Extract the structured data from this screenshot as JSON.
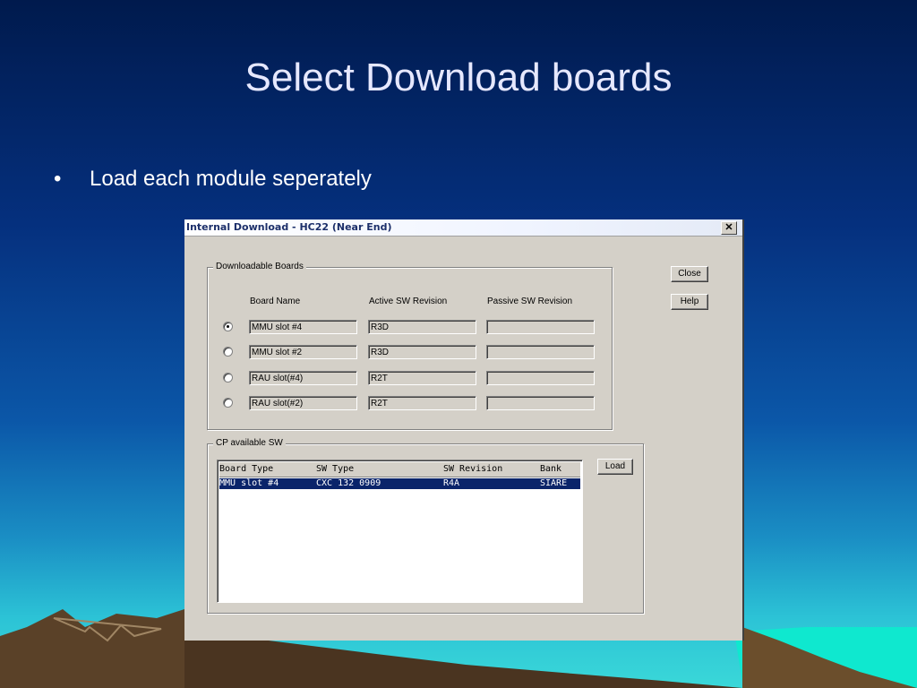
{
  "slide": {
    "title": "Select Download boards",
    "bullet_marker": "•",
    "bullet": "Load each module seperately"
  },
  "dialog": {
    "title": "Internal Download  -  HC22  (Near End)",
    "close_glyph": "✕",
    "downloadable_group_label": "Downloadable Boards",
    "columns": {
      "board_name": "Board Name",
      "active_sw": "Active SW Revision",
      "passive_sw": "Passive SW Revision"
    },
    "boards": [
      {
        "name": "MMU slot #4",
        "active": "R3D",
        "passive": "",
        "selected": true
      },
      {
        "name": "MMU slot #2",
        "active": "R3D",
        "passive": "",
        "selected": false
      },
      {
        "name": "RAU slot(#4)",
        "active": "R2T",
        "passive": "",
        "selected": false
      },
      {
        "name": "RAU slot(#2)",
        "active": "R2T",
        "passive": "",
        "selected": false
      }
    ],
    "buttons": {
      "close": "Close",
      "help": "Help",
      "load": "Load"
    },
    "cp_group_label": "CP available SW",
    "sw_list": {
      "headers": {
        "board_type": "Board Type",
        "sw_type": "SW Type",
        "sw_revision": "SW Revision",
        "bank": "Bank"
      },
      "rows": [
        {
          "board_type": "MMU slot #4",
          "sw_type": "CXC 132 0909",
          "sw_revision": "R4A",
          "bank": "SIARE"
        }
      ]
    }
  }
}
